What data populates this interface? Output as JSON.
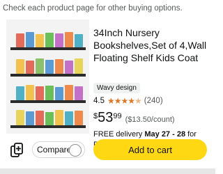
{
  "notice": "Check each product page for other buying options.",
  "product": {
    "title": "34Inch Nursery Bookshelves,Set of 4,Wall Floating Shelf Kids Coat Ra...",
    "brand": "Wavy design",
    "rating": "4.5",
    "stars_icon": "star-rating-icon",
    "reviews": "(240)",
    "price_currency": "$",
    "price_whole": "53",
    "price_fraction": "99",
    "unit_price": "($13.50/count)",
    "delivery_prefix": "FREE delivery ",
    "delivery_dates": "May 27 - 28",
    "delivery_suffix": " for Prime members"
  },
  "actions": {
    "compare_label": "Compare",
    "add_to_cart": "Add to cart"
  },
  "colors": {
    "accent_button": "#ffd814",
    "star": "#de7921"
  }
}
